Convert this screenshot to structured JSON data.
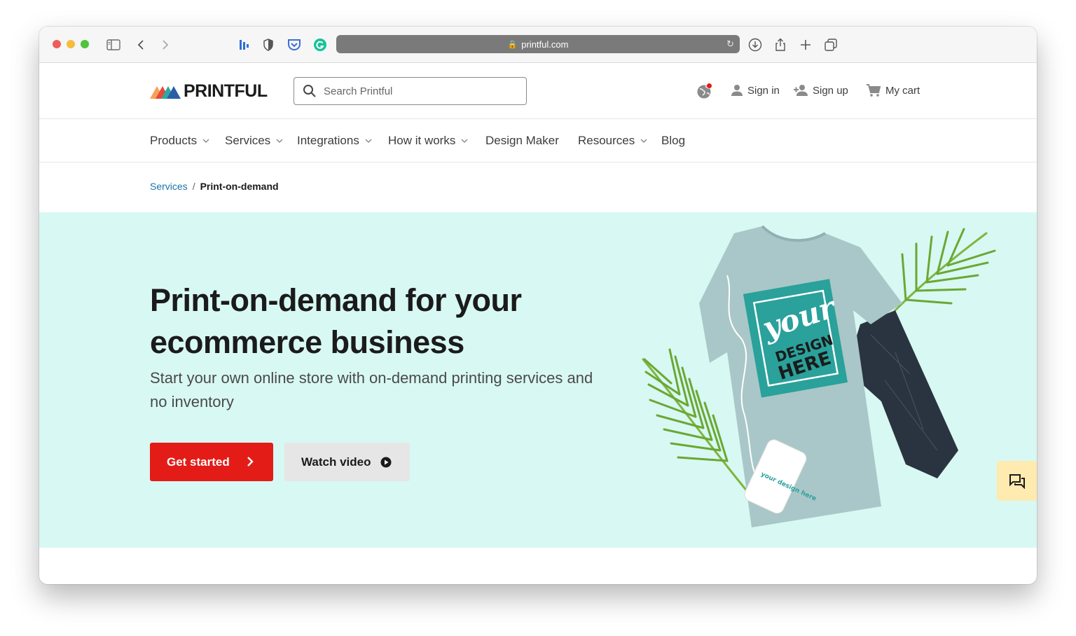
{
  "browser": {
    "url": "printful.com"
  },
  "header": {
    "logo_text": "PRINTFUL",
    "search_placeholder": "Search Printful",
    "sign_in": "Sign in",
    "sign_up": "Sign up",
    "cart": "My cart"
  },
  "nav": {
    "items": [
      {
        "label": "Products",
        "dropdown": true
      },
      {
        "label": "Services",
        "dropdown": true
      },
      {
        "label": "Integrations",
        "dropdown": true
      },
      {
        "label": "How it works",
        "dropdown": true
      },
      {
        "label": "Design Maker",
        "dropdown": false
      },
      {
        "label": "Resources",
        "dropdown": true
      },
      {
        "label": "Blog",
        "dropdown": false
      }
    ]
  },
  "breadcrumb": {
    "parent": "Services",
    "separator": "/",
    "current": "Print-on-demand"
  },
  "hero": {
    "title": "Print-on-demand for your ecommerce business",
    "subtitle": "Start your own online store with on-demand printing services and no inventory",
    "primary_button": "Get started",
    "secondary_button": "Watch video",
    "shirt_print_line1": "your",
    "shirt_print_line2": "DESIGN",
    "shirt_print_line3": "HERE",
    "phone_print": "your design here"
  },
  "colors": {
    "brand_red": "#e31c17",
    "hero_bg": "#d8f8f3",
    "link_blue": "#1a73a8",
    "chat_bg": "#ffeab0"
  }
}
